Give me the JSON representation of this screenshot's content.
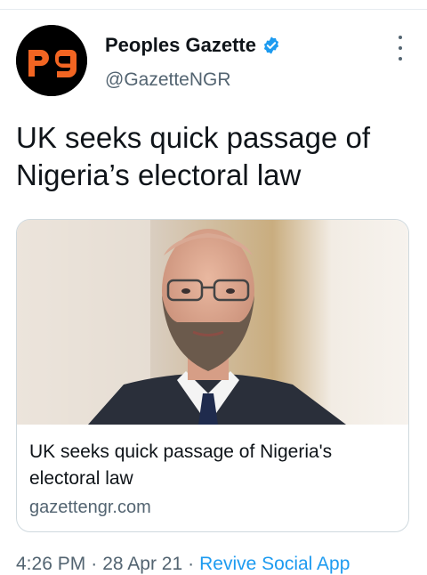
{
  "account": {
    "avatar_text": "pg",
    "name": "Peoples Gazette",
    "handle": "@GazetteNGR",
    "verified": true
  },
  "tweet": {
    "text": "UK seeks quick passage of Nigeria’s electoral law"
  },
  "card": {
    "title": "UK seeks quick passage of Nigeria's electoral law",
    "domain": "gazettengr.com"
  },
  "meta": {
    "time": "4:26 PM",
    "separator": "·",
    "date": "28 Apr 21",
    "source_app": "Revive Social App"
  },
  "colors": {
    "accent": "#1d9bf0",
    "avatar_orange": "#f26522",
    "secondary_text": "#536471"
  },
  "icons": {
    "verified": "verified-badge-icon",
    "more": "more-options-icon"
  }
}
